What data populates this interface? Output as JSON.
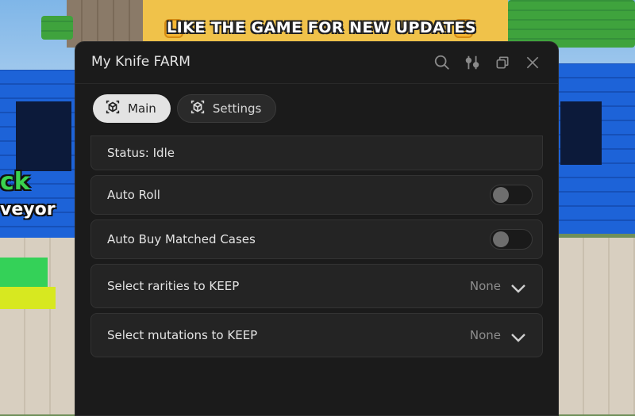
{
  "game": {
    "banner_text": "LIKE THE GAME FOR NEW UPDATES",
    "side_text_1": "ck",
    "side_text_2": "veyor"
  },
  "window": {
    "title": "My Knife FARM",
    "title_icons": [
      "search-icon",
      "sliders-icon",
      "copy-icon",
      "close-icon"
    ]
  },
  "tabs": [
    {
      "label": "Main",
      "icon": "cube-icon",
      "active": true
    },
    {
      "label": "Settings",
      "icon": "cube-icon",
      "active": false
    }
  ],
  "main": {
    "status": "Status: Idle",
    "toggles": [
      {
        "label": "Auto Roll",
        "on": false
      },
      {
        "label": "Auto Buy Matched Cases",
        "on": false
      }
    ],
    "dropdowns": [
      {
        "label": "Select rarities to KEEP",
        "value": "None"
      },
      {
        "label": "Select mutations to KEEP",
        "value": "None"
      }
    ]
  },
  "colors": {
    "window_bg": "#1b1b1b",
    "row_bg": "#242424",
    "active_tab_bg": "#e3e3e3",
    "text": "#e4e4e4",
    "muted_text": "#8d8d8d"
  }
}
